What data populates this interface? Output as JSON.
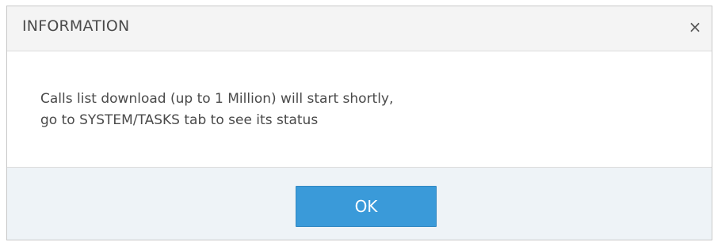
{
  "dialog": {
    "title": "INFORMATION",
    "close_icon": "×",
    "message_line1": "Calls list download (up to 1 Million) will start shortly,",
    "message_line2": "go to SYSTEM/TASKS tab to see its status",
    "ok_label": "OK"
  },
  "colors": {
    "header_bg": "#f4f4f4",
    "footer_bg": "#eef3f7",
    "button_bg": "#3a9ad9",
    "text": "#4a4a4a"
  }
}
